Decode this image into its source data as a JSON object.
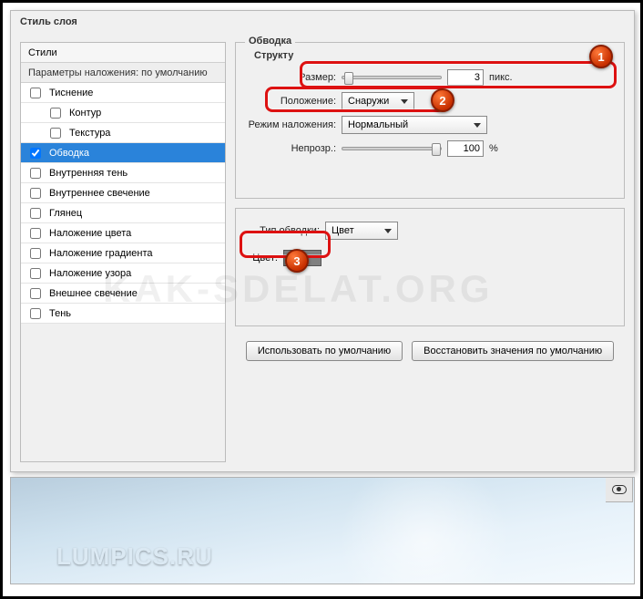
{
  "dialog": {
    "title": "Стиль слоя"
  },
  "styles_panel": {
    "header": "Стили",
    "params": "Параметры наложения: по умолчанию",
    "items": [
      {
        "label": "Тиснение",
        "checked": false,
        "indent": false
      },
      {
        "label": "Контур",
        "checked": false,
        "indent": true
      },
      {
        "label": "Текстура",
        "checked": false,
        "indent": true
      },
      {
        "label": "Обводка",
        "checked": true,
        "indent": false,
        "selected": true
      },
      {
        "label": "Внутренняя тень",
        "checked": false,
        "indent": false
      },
      {
        "label": "Внутреннее свечение",
        "checked": false,
        "indent": false
      },
      {
        "label": "Глянец",
        "checked": false,
        "indent": false
      },
      {
        "label": "Наложение цвета",
        "checked": false,
        "indent": false
      },
      {
        "label": "Наложение градиента",
        "checked": false,
        "indent": false
      },
      {
        "label": "Наложение узора",
        "checked": false,
        "indent": false
      },
      {
        "label": "Внешнее свечение",
        "checked": false,
        "indent": false
      },
      {
        "label": "Тень",
        "checked": false,
        "indent": false
      }
    ]
  },
  "stroke": {
    "section_title": "Обводка",
    "sub_title": "Структу",
    "size_label": "Размер:",
    "size_value": "3",
    "size_unit": "пикс.",
    "position_label": "Положение:",
    "position_value": "Снаружи",
    "blend_label": "Режим наложения:",
    "blend_value": "Нормальный",
    "opacity_label": "Непрозр.:",
    "opacity_value": "100",
    "opacity_unit": "%",
    "filltype_label": "Тип обводки:",
    "filltype_value": "Цвет",
    "color_label": "Цвет:",
    "color_value": "#808080"
  },
  "buttons": {
    "make_default": "Использовать по умолчанию",
    "reset_default": "Восстановить значения по умолчанию"
  },
  "callouts": {
    "c1": "1",
    "c2": "2",
    "c3": "3"
  },
  "watermark": "KAK-SDELAT.ORG",
  "brand": "LUMPICS.RU"
}
